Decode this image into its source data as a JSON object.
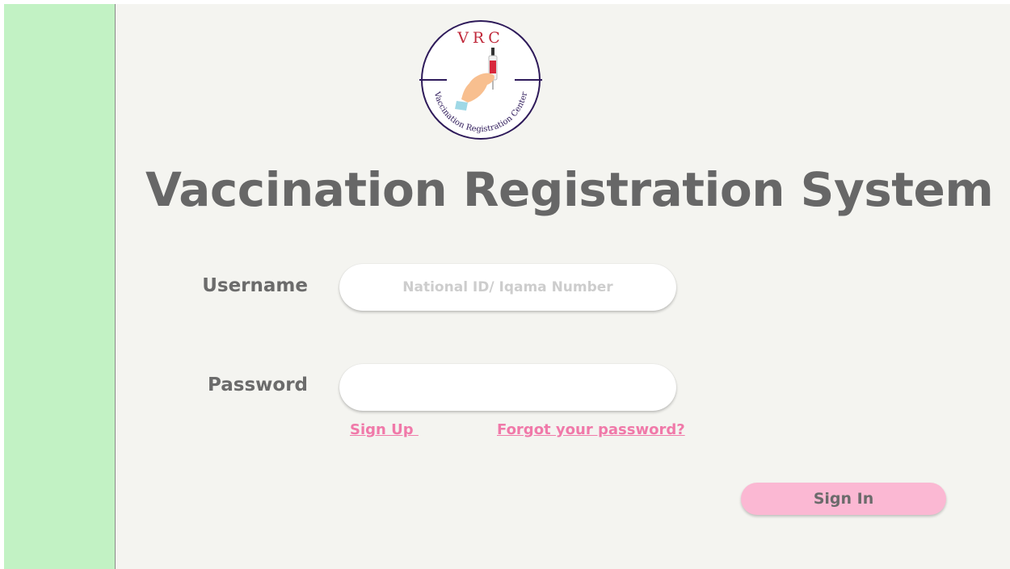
{
  "logo": {
    "initials": "VRC",
    "ring_text": "Vaccination Registration Center",
    "icon": "syringe-hand-icon"
  },
  "title": "Vaccination Registration System",
  "form": {
    "username_label": "Username",
    "username_placeholder": "National ID/ Iqama Number",
    "username_value": "",
    "password_label": "Password",
    "password_value": ""
  },
  "links": {
    "sign_up": "Sign Up ",
    "forgot_password": "Forgot your password?"
  },
  "actions": {
    "sign_in": "Sign In"
  },
  "colors": {
    "sidebar": "#c2f2c4",
    "background": "#f4f4f0",
    "link": "#f079a9",
    "button": "#fbb8d3",
    "text": "#676767",
    "logo_ring": "#2e1a5a",
    "logo_initials": "#c0283a"
  }
}
